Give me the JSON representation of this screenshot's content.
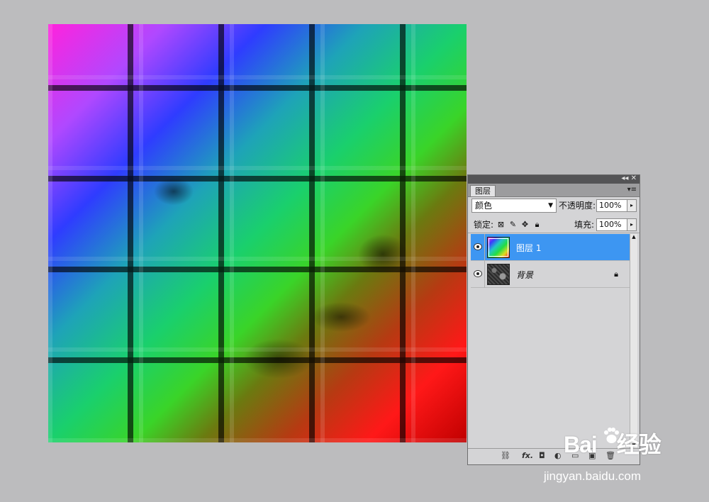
{
  "panel": {
    "tab_label": "图层",
    "blend_mode": "颜色",
    "opacity_label": "不透明度:",
    "opacity_value": "100%",
    "lock_label": "锁定:",
    "fill_label": "填充:",
    "fill_value": "100%",
    "layers": [
      {
        "name": "图层 1",
        "selected": true,
        "thumbnail": "rainbow-gradient",
        "visible": true
      },
      {
        "name": "背景",
        "selected": false,
        "thumbnail": "dark-texture",
        "visible": true,
        "locked": true
      }
    ]
  },
  "watermark": {
    "logo_left": "Bai",
    "logo_right": "经验",
    "url": "jingyan.baidu.com"
  },
  "colors": {
    "selection": "#3d96f2",
    "panel_bg": "#d4d4d6",
    "workspace_bg": "#bcbcbe"
  }
}
